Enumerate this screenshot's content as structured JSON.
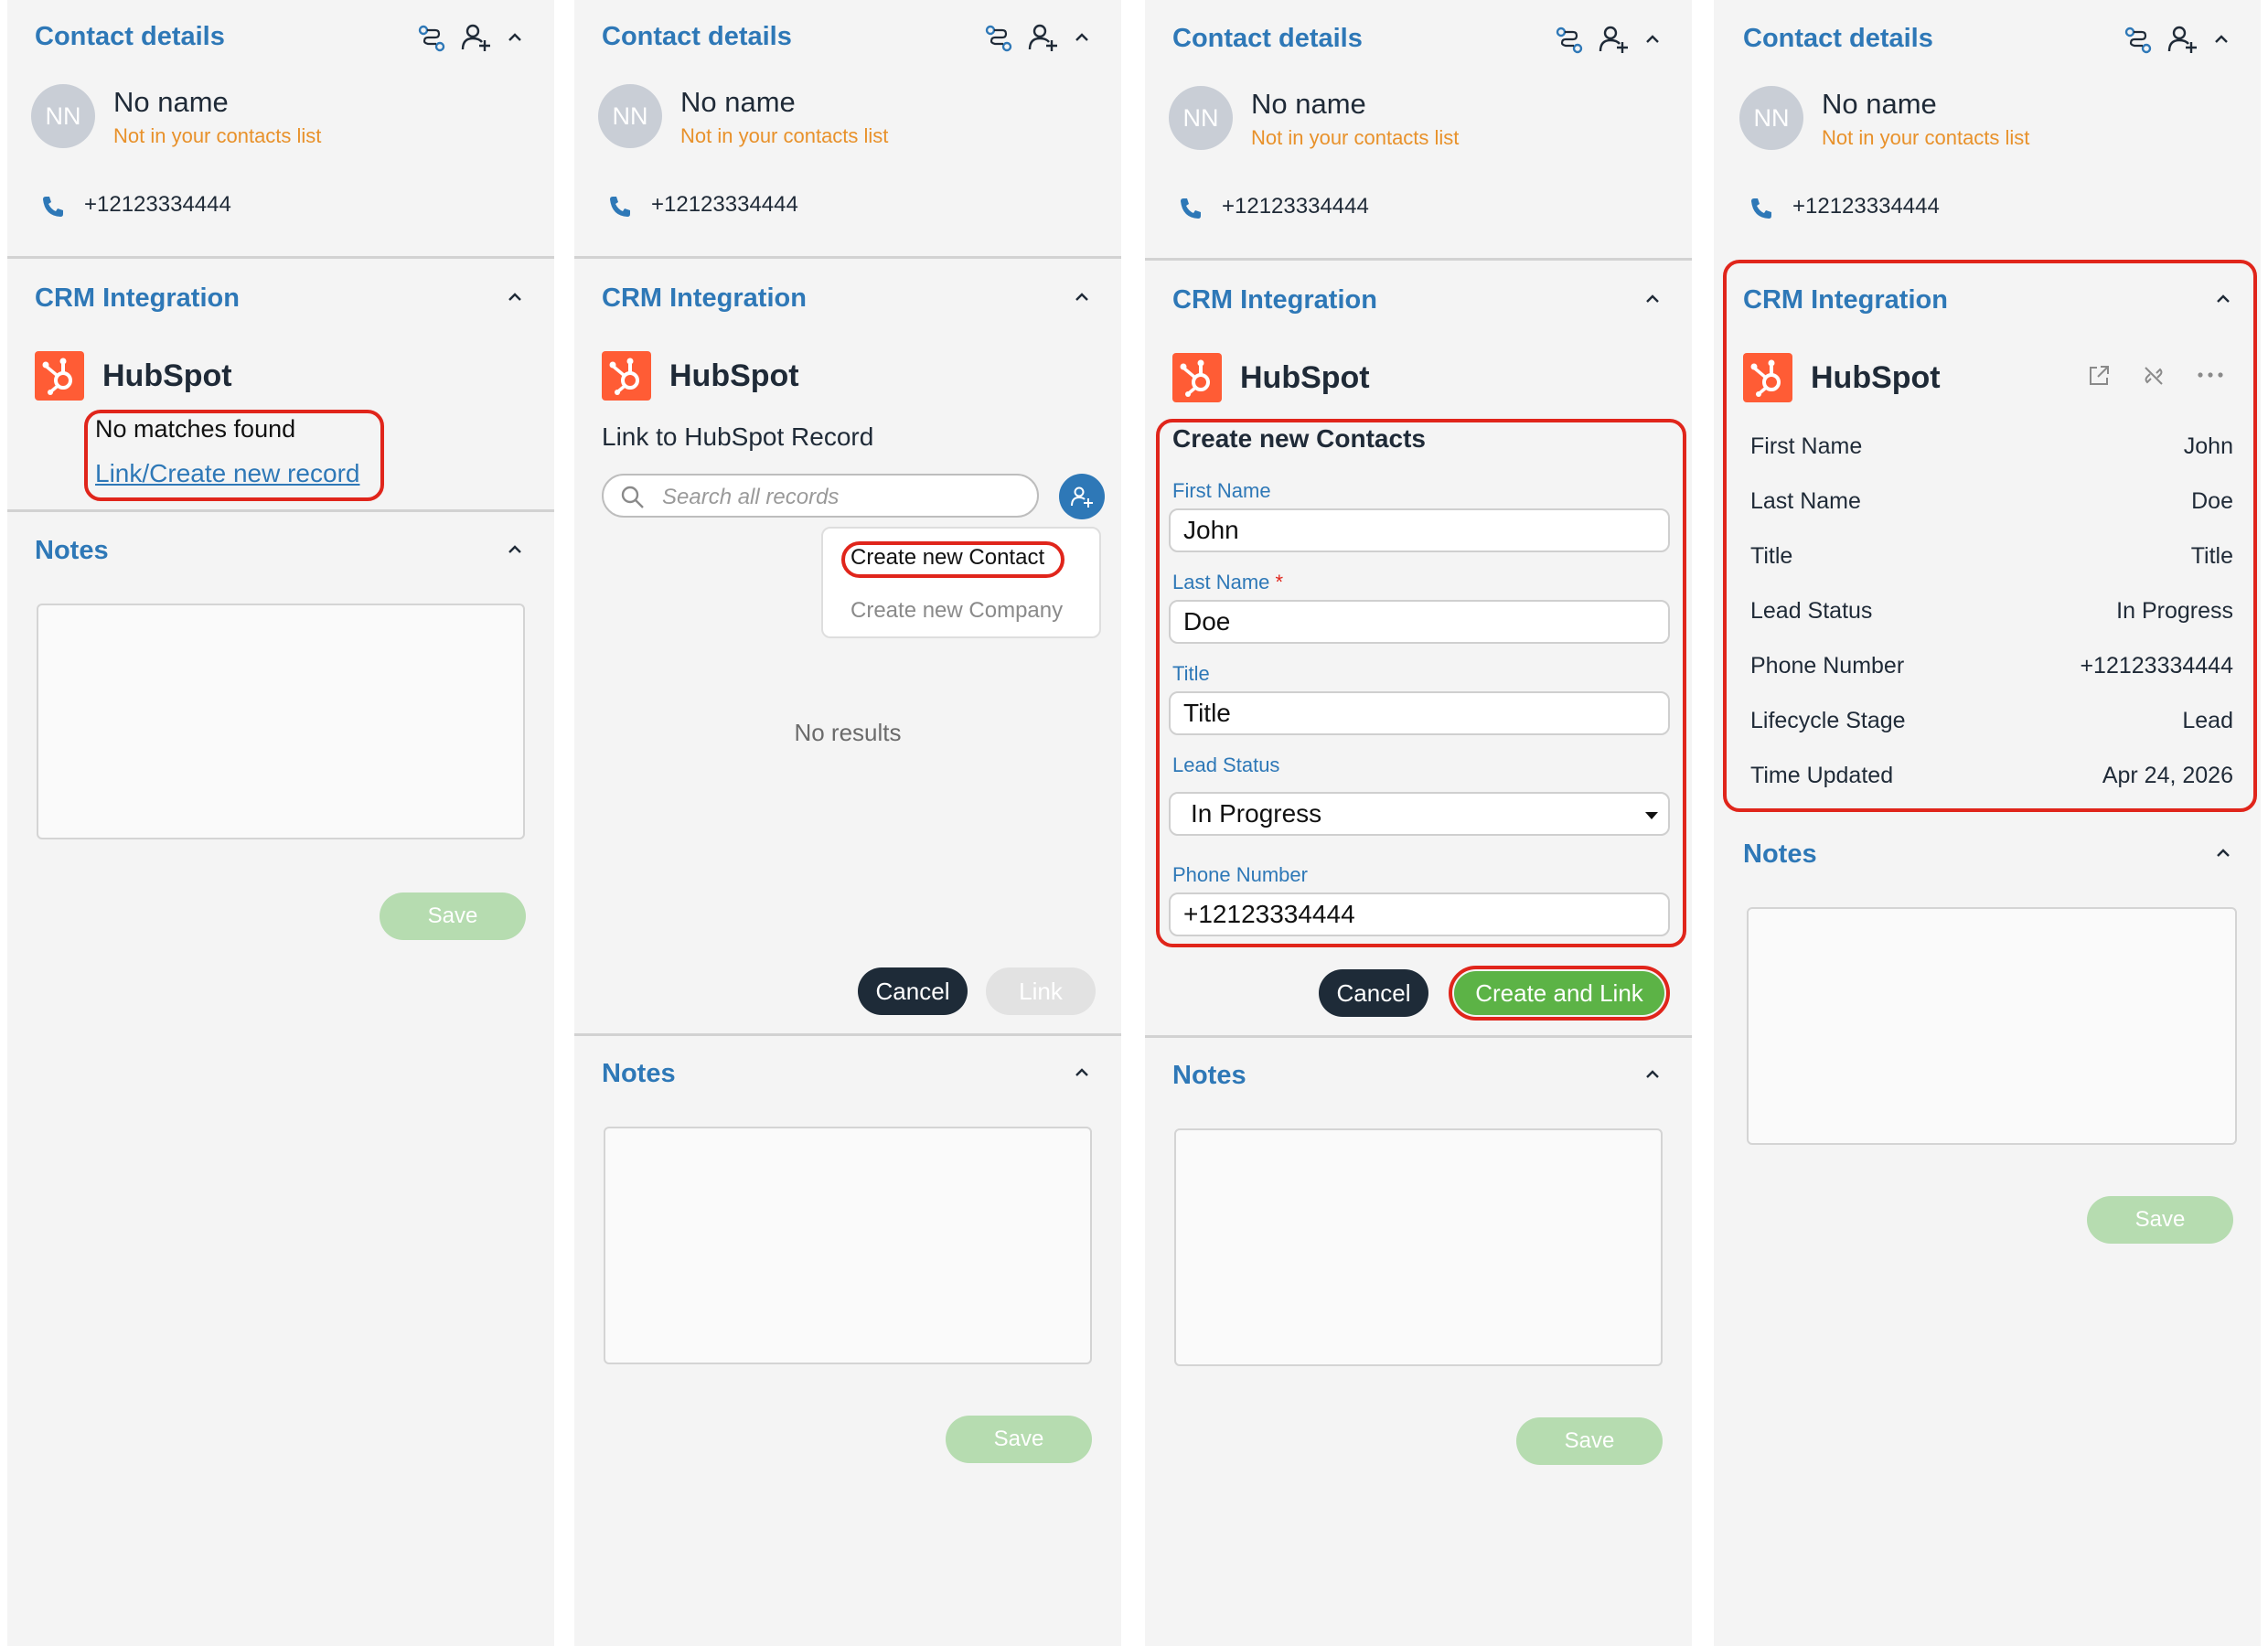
{
  "contact": {
    "section_title": "Contact details",
    "avatar_initials": "NN",
    "name": "No name",
    "status": "Not in your contacts list",
    "phone": "+12123334444"
  },
  "crm": {
    "section_title": "CRM Integration",
    "provider": "HubSpot"
  },
  "notes": {
    "section_title": "Notes",
    "save_label": "Save"
  },
  "panel1": {
    "no_matches": "No matches found",
    "link_create": "Link/Create new record"
  },
  "panel2": {
    "link_title": "Link to HubSpot Record",
    "search_placeholder": "Search all records",
    "menu_create_contact": "Create new Contact",
    "menu_create_company": "Create new Company",
    "no_results": "No results",
    "cancel_label": "Cancel",
    "link_label": "Link"
  },
  "panel3": {
    "form_title": "Create new Contacts",
    "first_name_label": "First Name",
    "first_name_value": "John",
    "last_name_label": "Last Name",
    "required_mark": "*",
    "last_name_value": "Doe",
    "title_label": "Title",
    "title_value": "Title",
    "lead_status_label": "Lead Status",
    "lead_status_value": "In Progress",
    "phone_label": "Phone Number",
    "phone_value": "+12123334444",
    "cancel_label": "Cancel",
    "create_link_label": "Create and Link"
  },
  "panel4": {
    "fields": [
      {
        "label": "First Name",
        "value": "John"
      },
      {
        "label": "Last Name",
        "value": "Doe"
      },
      {
        "label": "Title",
        "value": "Title"
      },
      {
        "label": "Lead Status",
        "value": "In Progress"
      },
      {
        "label": "Phone Number",
        "value": "+12123334444"
      },
      {
        "label": "Lifecycle Stage",
        "value": "Lead"
      },
      {
        "label": "Time Updated",
        "value": "Apr 24, 2026"
      }
    ]
  },
  "colors": {
    "accent_blue": "#2e78b7",
    "warning_orange": "#e8912a",
    "hubspot_orange": "#ff5c35",
    "highlight_red": "#e0251b",
    "primary_green": "#5cb346",
    "disabled_green": "#b6dcb0"
  }
}
